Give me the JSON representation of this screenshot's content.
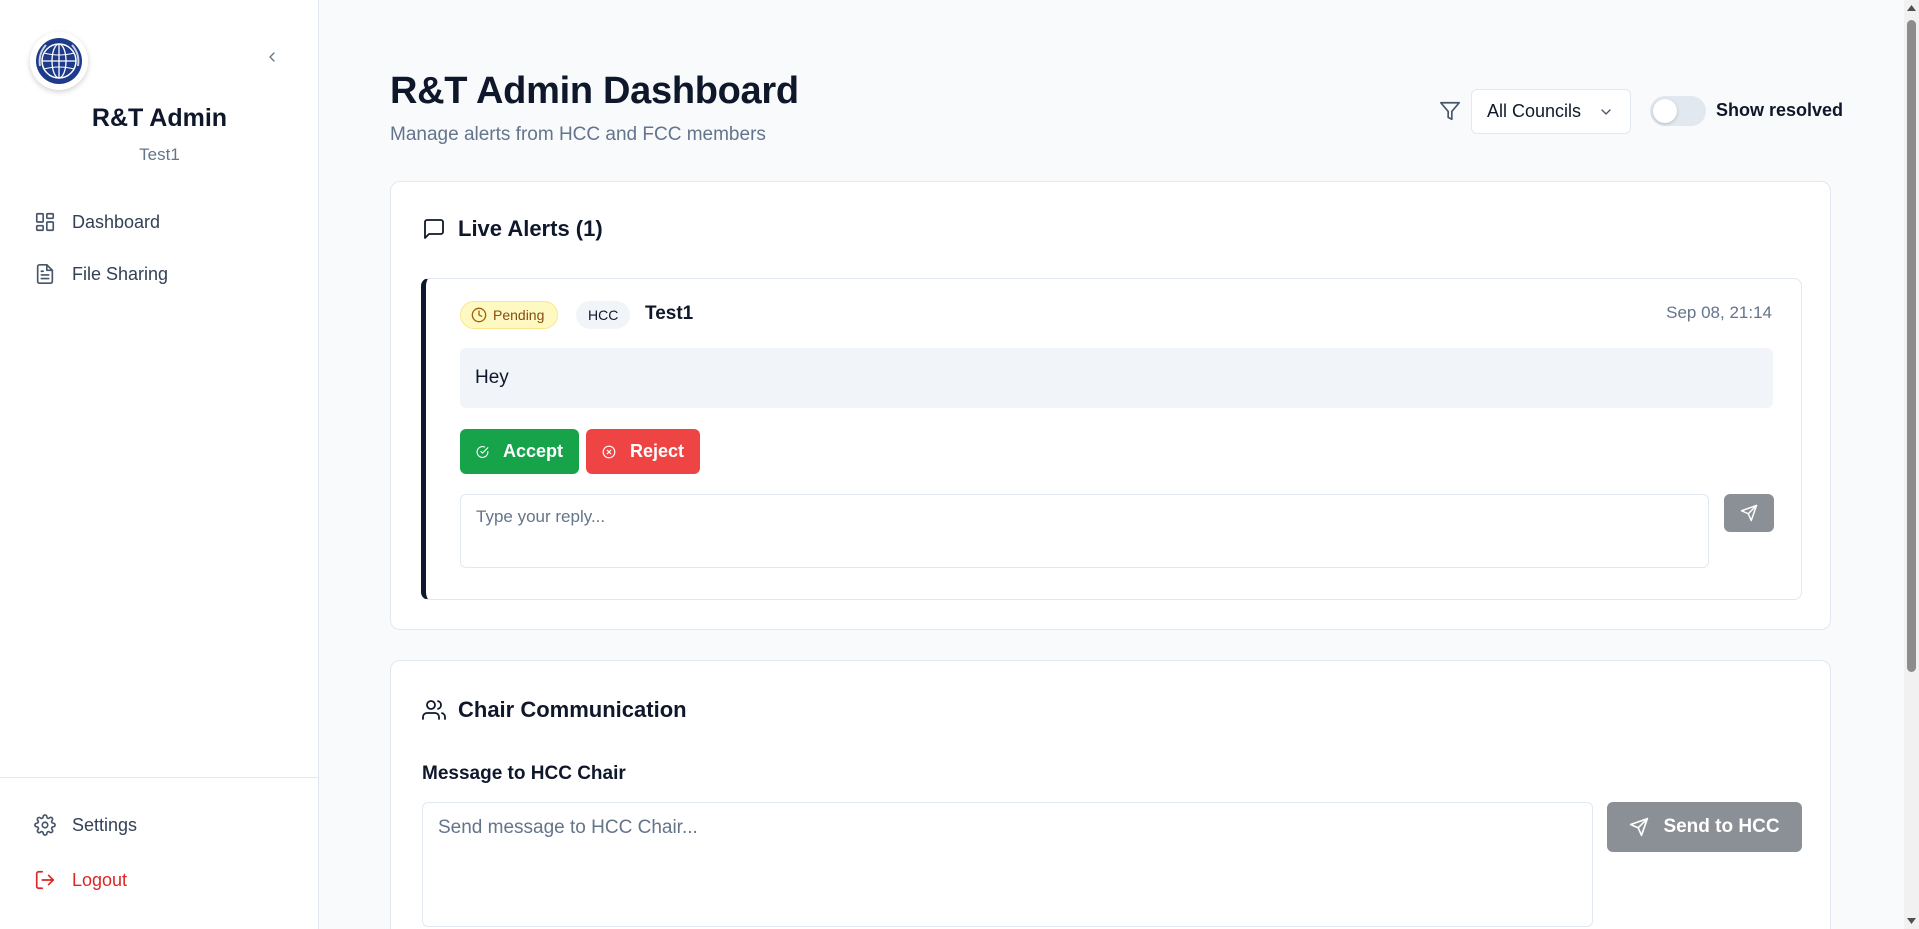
{
  "sidebar": {
    "title": "R&T Admin",
    "subtitle": "Test1",
    "logo_icon": "globe-emblem-icon",
    "collapse_icon": "chevron-left-icon",
    "nav": [
      {
        "label": "Dashboard",
        "icon": "layout-grid-icon"
      },
      {
        "label": "File Sharing",
        "icon": "file-text-icon"
      }
    ],
    "footer": [
      {
        "label": "Settings",
        "icon": "gear-icon"
      },
      {
        "label": "Logout",
        "icon": "logout-icon"
      }
    ]
  },
  "header": {
    "title": "R&T Admin Dashboard",
    "subtitle": "Manage alerts from HCC and FCC members",
    "filter_icon": "filter-icon",
    "council_select": "All Councils",
    "toggle_label": "Show resolved",
    "toggle_on": false
  },
  "alerts": {
    "heading": "Live Alerts (1)",
    "items": [
      {
        "status": "Pending",
        "council": "HCC",
        "user": "Test1",
        "time": "Sep 08, 21:14",
        "message": "Hey",
        "accept_label": "Accept",
        "reject_label": "Reject",
        "reply_placeholder": "Type your reply..."
      }
    ]
  },
  "chair": {
    "heading": "Chair Communication",
    "label": "Message to HCC Chair",
    "placeholder": "Send message to HCC Chair...",
    "send_label": "Send to HCC"
  },
  "colors": {
    "accept": "#16a34a",
    "reject": "#ef4444",
    "pending_bg": "#fef9c3",
    "logout": "#dc2626",
    "disabled_button": "#8b9097"
  }
}
